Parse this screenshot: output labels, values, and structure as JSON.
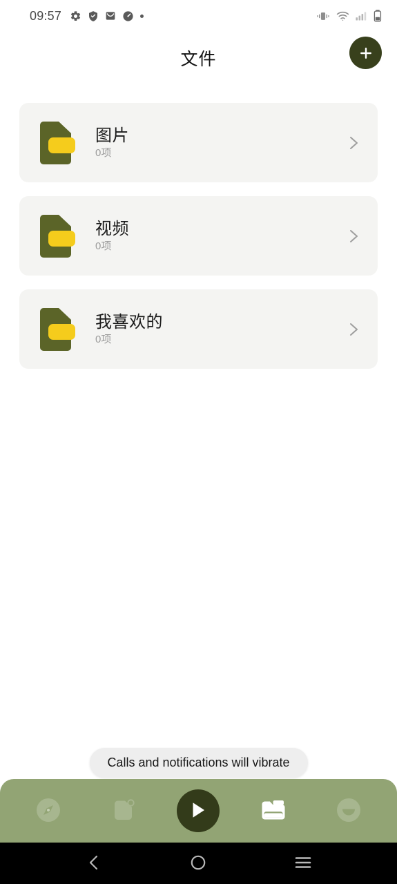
{
  "status_bar": {
    "time": "09:57",
    "left_icons": [
      "gear-icon",
      "shield-check-icon",
      "mail-icon",
      "speedometer-icon",
      "dot-icon"
    ],
    "right_icons": [
      "vibrate-icon",
      "wifi-icon",
      "signal-icon",
      "battery-icon"
    ]
  },
  "header": {
    "title": "文件",
    "add_button_label": "+",
    "fab_color": "#38401c"
  },
  "list": {
    "items": [
      {
        "title": "图片",
        "subtitle": "0项",
        "icon": "folder-icon",
        "chevron": "chevron-right-icon"
      },
      {
        "title": "视频",
        "subtitle": "0项",
        "icon": "folder-icon",
        "chevron": "chevron-right-icon"
      },
      {
        "title": "我喜欢的",
        "subtitle": "0项",
        "icon": "folder-icon",
        "chevron": "chevron-right-icon"
      }
    ],
    "card_color": "#f4f4f2",
    "folder_body_color": "#5b6428",
    "folder_tab_color": "#f5cc1c"
  },
  "toast": {
    "message": "Calls and notifications will vibrate"
  },
  "bottom_nav": {
    "background": "#92a474",
    "items": [
      {
        "name": "compass-icon",
        "active": false
      },
      {
        "name": "document-badge-icon",
        "active": false
      },
      {
        "name": "play-icon",
        "active": true
      },
      {
        "name": "folder-icon",
        "active": true
      },
      {
        "name": "account-icon",
        "active": false
      }
    ]
  },
  "system_nav": {
    "items": [
      "back-icon",
      "home-icon",
      "recents-icon"
    ]
  }
}
